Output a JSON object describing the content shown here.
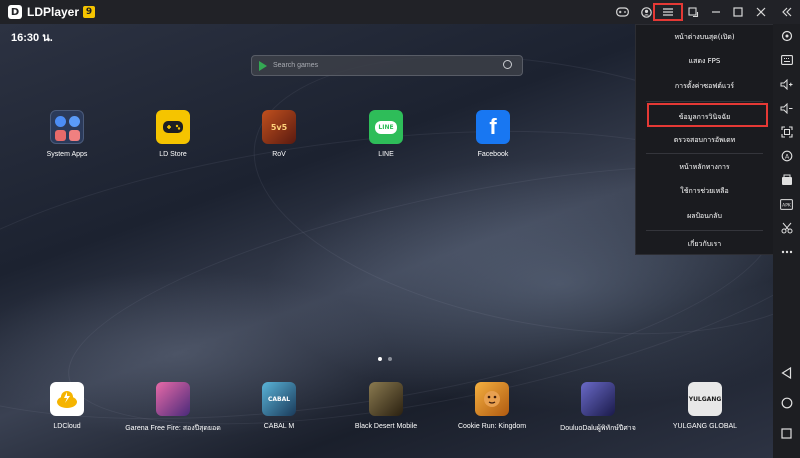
{
  "app": {
    "title": "LDPlayer",
    "version_badge": "9"
  },
  "titlebar_icons": [
    "gamepad-icon",
    "account-icon",
    "menu-icon",
    "sync-icon",
    "minimize-icon",
    "maximize-icon",
    "close-icon",
    "collapse-sidebar-icon"
  ],
  "statusbar": {
    "time": "16:30 น."
  },
  "search": {
    "placeholder": "Search games"
  },
  "desktop_apps": [
    {
      "label": "System Apps",
      "icon": "system-apps-icon",
      "color": "#2b3a5a"
    },
    {
      "label": "LD Store",
      "icon": "ld-store-icon",
      "color": "#f5c400"
    },
    {
      "label": "RoV",
      "icon": "rov-icon",
      "color": "#7a2a1a"
    },
    {
      "label": "LINE",
      "icon": "line-icon",
      "color": "#2ebd59"
    },
    {
      "label": "Facebook",
      "icon": "facebook-icon",
      "color": "#1877f2"
    }
  ],
  "dock_apps": [
    {
      "label": "LDCloud",
      "icon": "ldcloud-icon",
      "color": "#ffffff"
    },
    {
      "label": "Garena Free Fire: สองปีสุดยอด",
      "icon": "free-fire-icon",
      "color": "#5a3a8a"
    },
    {
      "label": "CABAL M",
      "icon": "cabal-m-icon",
      "color": "#2a5a7a"
    },
    {
      "label": "Black Desert Mobile",
      "icon": "black-desert-icon",
      "color": "#4a3a20"
    },
    {
      "label": "Cookie Run: Kingdom",
      "icon": "cookie-run-icon",
      "color": "#c8761a"
    },
    {
      "label": "DouluoDaluผู้พิทักษ์ปีศาจ",
      "icon": "douluo-icon",
      "color": "#3a3a7a"
    },
    {
      "label": "YULGANG GLOBAL",
      "icon": "yulgang-icon",
      "color": "#d8d8d8"
    }
  ],
  "page_indicator": {
    "pages": 2,
    "current": 1
  },
  "menu": {
    "items": [
      "หน้าต่างบนสุด(เปิด)",
      "แสดง FPS",
      "การตั้งค่าซอฟต์แวร์",
      "ข้อมูลการวินิจฉัย",
      "ตรวจสอบการอัพเดท",
      "หน้าหลักทางการ",
      "ใช้การช่วยเหลือ",
      "ผลป้อนกลับ",
      "เกี่ยวกับเรา"
    ],
    "highlighted_index": 3
  },
  "sidebar_icons": [
    "settings-icon",
    "keyboard-icon",
    "volume-up-icon",
    "volume-down-icon",
    "screenshot-icon",
    "sync-controls-icon",
    "install-apk-icon",
    "fps-icon",
    "cut-icon",
    "more-icon",
    "back-icon",
    "home-icon",
    "recents-icon"
  ],
  "colors": {
    "highlight": "#e53935",
    "badge": "#f5c400",
    "titlebar": "#212227"
  }
}
